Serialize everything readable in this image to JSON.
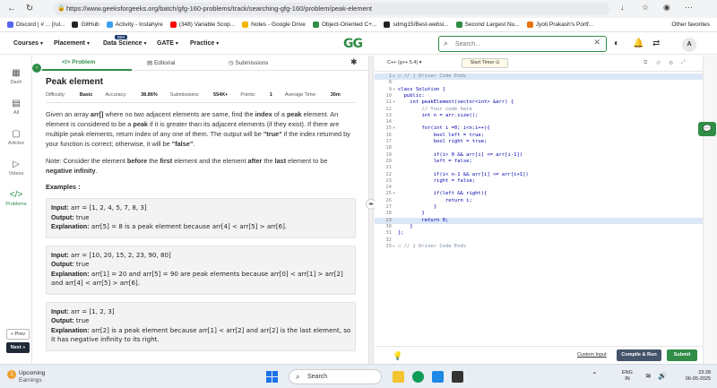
{
  "browser": {
    "url": "https://www.geeksforgeeks.org/batch/gfg-160-problems/track/searching-gfg-160/problem/peak-element",
    "bookmarks": [
      {
        "label": "Discord | # ... [rul...",
        "color": "#5865f2"
      },
      {
        "label": "GitHub",
        "color": "#222222"
      },
      {
        "label": "Activity - Instahyre",
        "color": "#3aa0f0"
      },
      {
        "label": "(348) Variable Scop...",
        "color": "#ff0000"
      },
      {
        "label": "Notes - Google Drive",
        "color": "#f4b400"
      },
      {
        "label": "Object-Oriented C+...",
        "color": "#2f8d46"
      },
      {
        "label": "sdmg15/Best-websi...",
        "color": "#222222"
      },
      {
        "label": "Second Largest Nu...",
        "color": "#2f8d46"
      },
      {
        "label": "Jyoti Prakash's Portf...",
        "color": "#e8710a"
      }
    ],
    "other_favorites": "Other favorites"
  },
  "header": {
    "nav": [
      "Courses",
      "Placement",
      "Data Science",
      "GATE",
      "Practice"
    ],
    "ibm_badge": "IBM",
    "logo": "GG",
    "search_placeholder": "Search...",
    "avatar": "A"
  },
  "rail": {
    "items": [
      {
        "label": "Dash",
        "icon": "▦"
      },
      {
        "label": "All",
        "icon": "▤"
      },
      {
        "label": "Articles",
        "icon": "▢"
      },
      {
        "label": "Videos",
        "icon": "▷"
      },
      {
        "label": "Problems",
        "icon": "</>"
      }
    ],
    "prev": "« Prev",
    "next": "Next »"
  },
  "problem": {
    "tabs": [
      "Problem",
      "Editorial",
      "Submissions"
    ],
    "title": "Peak element",
    "difficulty_label": "Difficulty:",
    "difficulty": "Basic",
    "accuracy_label": "Accuracy:",
    "accuracy": "38.86%",
    "submissions_label": "Submissions:",
    "submissions": "554K+",
    "points_label": "Points:",
    "points": "1",
    "time_label": "Average Time:",
    "time": "30m",
    "desc_1": "Given an array ",
    "desc_arr": "arr[]",
    "desc_2": " where no two adjacent elements are same, find the ",
    "desc_index": "index",
    "desc_3": " of a ",
    "desc_peak": "peak",
    "desc_4": " element. An element is considered to be a ",
    "desc_peak2": "peak",
    "desc_5": " if it is greater than its adjacent elements (if they exist). If there are multiple peak elements, return index of any one of them. The output will be ",
    "desc_true": "\"true\"",
    "desc_6": " if the index returned by your function is correct; otherwise, it will be ",
    "desc_false": "\"false\"",
    "desc_7": ".",
    "note_1": "Note: Consider the element ",
    "note_before": "before",
    "note_2": " the ",
    "note_first": "first",
    "note_3": " element and the element ",
    "note_after": "after",
    "note_4": " the ",
    "note_last": "last",
    "note_5": " element to be ",
    "note_neg": "negative infinity",
    "note_6": ".",
    "examples_heading": "Examples :",
    "input_label": "Input:",
    "output_label": "Output:",
    "explanation_label": "Explanation:",
    "examples": [
      {
        "input": "arr = [1, 2, 4, 5, 7, 8, 3]",
        "output": "true",
        "explanation": "arr[5] = 8 is a peak element because arr[4] < arr[5] > arr[6]."
      },
      {
        "input": "arr = [10, 20, 15, 2, 23, 90, 80]",
        "output": "true",
        "explanation": "arr[1] = 20 and arr[5] = 90 are peak elements because arr[0] < arr[1] > arr[2] and arr[4] < arr[5] > arr[6]."
      },
      {
        "input": "arr = [1, 2, 3]",
        "output": "true",
        "explanation": "arr[2] is a peak element because arr[1] < arr[2] and arr[2] is the last element, so it has negative infinity to its right."
      }
    ]
  },
  "editor": {
    "language": "C++ (g++ 5.4) ▾",
    "start_timer": "Start Timer ⊙",
    "custom_input": "Custom Input",
    "compile_run": "Compile & Run",
    "submit": "Submit",
    "lines": [
      {
        "n": "1",
        "fold": "▸",
        "text": "▭ // } Driver Code Ends",
        "hl": true
      },
      {
        "n": "8",
        "fold": "",
        "text": ""
      },
      {
        "n": "9",
        "fold": "▾",
        "text": "class Solution {"
      },
      {
        "n": "10",
        "fold": "",
        "text": "  public:"
      },
      {
        "n": "11",
        "fold": "▾",
        "text": "    int peakElement(vector<int> &arr) {"
      },
      {
        "n": "12",
        "fold": "",
        "text": "        // Your code here"
      },
      {
        "n": "13",
        "fold": "",
        "text": "        int n = arr.size();"
      },
      {
        "n": "14",
        "fold": "",
        "text": ""
      },
      {
        "n": "15",
        "fold": "▾",
        "text": "        for(int i =0; i<n;i++){"
      },
      {
        "n": "16",
        "fold": "",
        "text": "            bool left = true;"
      },
      {
        "n": "17",
        "fold": "",
        "text": "            bool right = true;"
      },
      {
        "n": "18",
        "fold": "",
        "text": ""
      },
      {
        "n": "19",
        "fold": "",
        "text": "            if(i> 0 && arr[i] <= arr[i-1])"
      },
      {
        "n": "20",
        "fold": "",
        "text": "            left = false;"
      },
      {
        "n": "21",
        "fold": "",
        "text": ""
      },
      {
        "n": "22",
        "fold": "",
        "text": "            if(i< n-1 && arr[i] <= arr[i+1])"
      },
      {
        "n": "23",
        "fold": "",
        "text": "            right = false;"
      },
      {
        "n": "24",
        "fold": "",
        "text": ""
      },
      {
        "n": "25",
        "fold": "▾",
        "text": "            if(left && right){"
      },
      {
        "n": "26",
        "fold": "",
        "text": "                return i;"
      },
      {
        "n": "27",
        "fold": "",
        "text": "            }"
      },
      {
        "n": "28",
        "fold": "",
        "text": "        }"
      },
      {
        "n": "29",
        "fold": "",
        "text": "        return 0;",
        "hl": true
      },
      {
        "n": "30",
        "fold": "",
        "text": "    }"
      },
      {
        "n": "31",
        "fold": "",
        "text": "};"
      },
      {
        "n": "32",
        "fold": "",
        "text": ""
      },
      {
        "n": "33",
        "fold": "▸",
        "text": "▭ // } Driver Code Ends"
      }
    ]
  },
  "taskbar": {
    "weather_title": "Upcoming",
    "weather_sub": "Earnings",
    "search": "Search",
    "lang_1": "ENG",
    "lang_2": "IN",
    "time": "23:28",
    "date": "06-05-2025"
  }
}
